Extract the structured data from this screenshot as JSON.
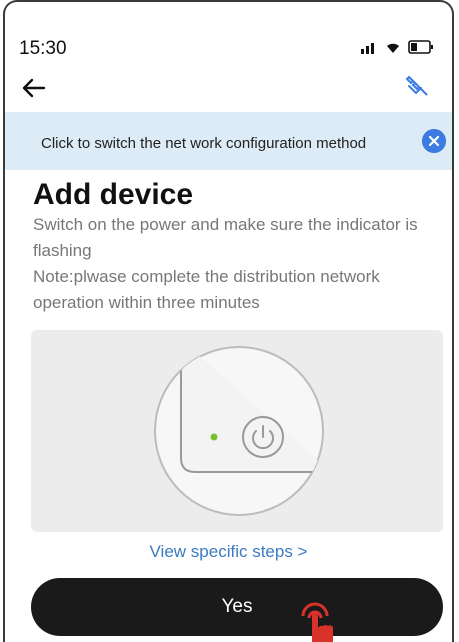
{
  "status_bar": {
    "time": "15:30"
  },
  "banner": {
    "text": "Click to switch the net work configuration method"
  },
  "main": {
    "title": "Add device",
    "instruction": "Switch on the  power and make sure the indicator is flashing",
    "note": "Note:plwase complete the distribution network operation within three minutes",
    "steps_link": "View specific steps >",
    "confirm_label": "Yes"
  },
  "colors": {
    "banner_bg": "#dcebf5",
    "accent": "#3c7be2",
    "link": "#3c7bbf",
    "button_bg": "#1a1a1a",
    "indicator": "#7bbf2e",
    "hand": "#d8322a"
  }
}
